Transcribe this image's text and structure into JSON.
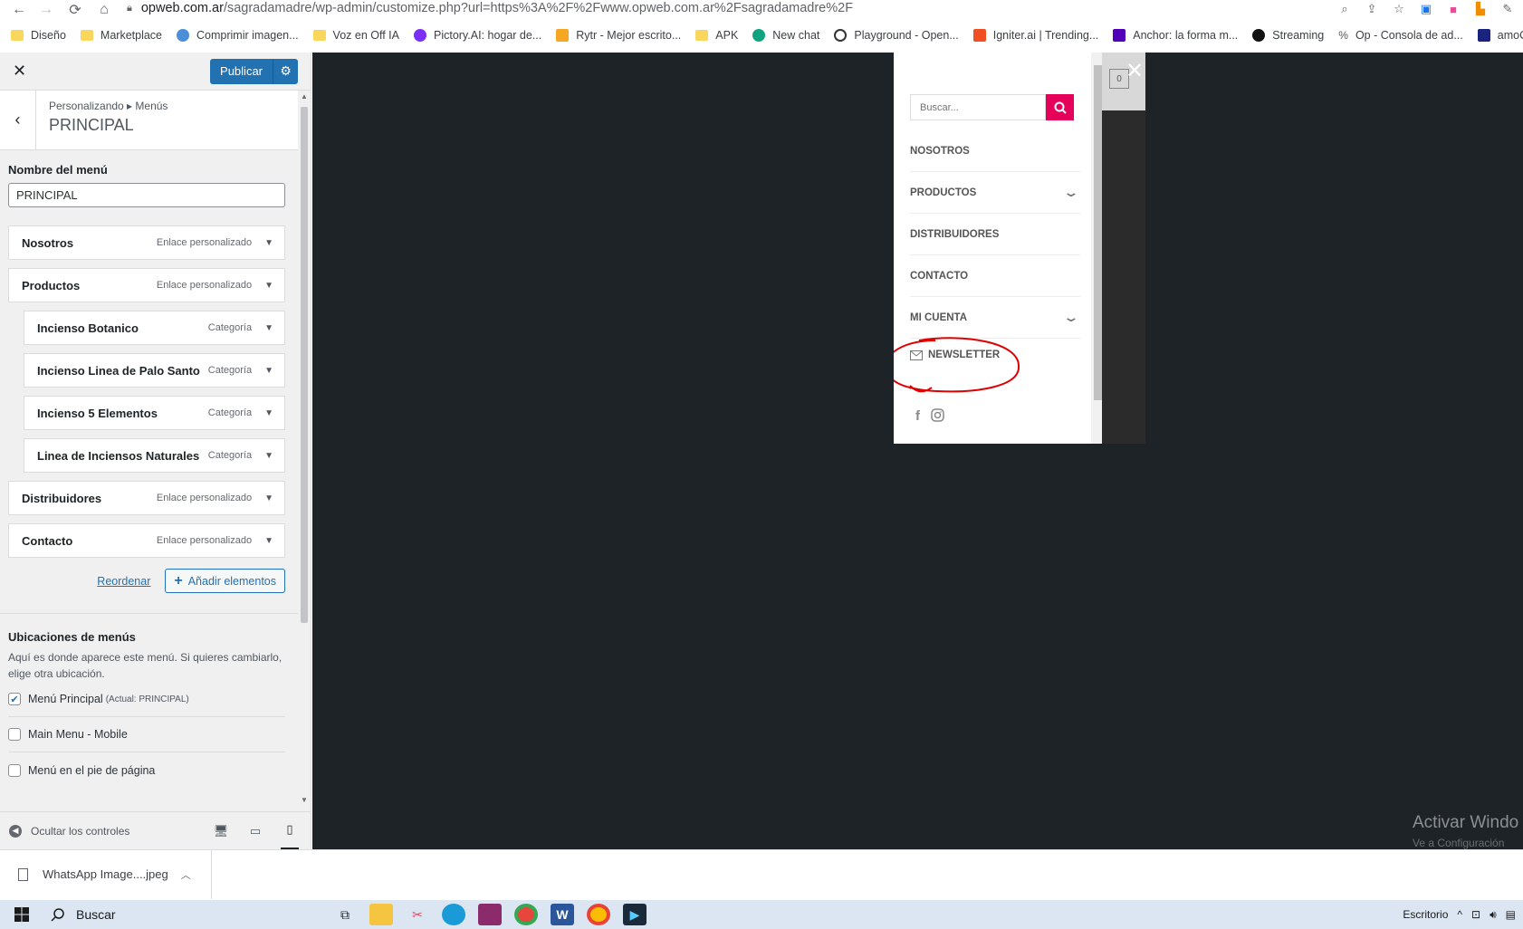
{
  "browser": {
    "url_domain": "opweb.com.ar",
    "url_path": "/sagradamadre/wp-admin/customize.php?url=https%3A%2F%2Fwww.opweb.com.ar%2Fsagradamadre%2F",
    "bookmarks": [
      {
        "label": "Diseño",
        "icon": "folder-icon"
      },
      {
        "label": "Marketplace",
        "icon": "folder-icon"
      },
      {
        "label": "Comprimir imagen...",
        "icon": "compress-icon"
      },
      {
        "label": "Voz en Off IA",
        "icon": "folder-icon"
      },
      {
        "label": "Pictory.AI: hogar de...",
        "icon": "pictory-icon"
      },
      {
        "label": "Rytr - Mejor escrito...",
        "icon": "rytr-icon"
      },
      {
        "label": "APK",
        "icon": "folder-icon"
      },
      {
        "label": "New chat",
        "icon": "chatgpt-icon"
      },
      {
        "label": "Playground - Open...",
        "icon": "openai-icon"
      },
      {
        "label": "Igniter.ai | Trending...",
        "icon": "igniter-icon"
      },
      {
        "label": "Anchor: la forma m...",
        "icon": "anchor-icon"
      },
      {
        "label": "Streaming",
        "icon": "streaming-icon"
      },
      {
        "label": "Op - Consola de ad...",
        "icon": "console-icon"
      },
      {
        "label": "amoCRM...",
        "icon": "amocrm-icon"
      }
    ]
  },
  "customizer": {
    "publish_label": "Publicar",
    "breadcrumb": "Personalizando ▸ Menús",
    "section_title": "PRINCIPAL",
    "menu_name_label": "Nombre del menú",
    "menu_name_value": "PRINCIPAL",
    "menu_items": [
      {
        "title": "Nosotros",
        "type": "Enlace personalizado",
        "sub": false
      },
      {
        "title": "Productos",
        "type": "Enlace personalizado",
        "sub": false
      },
      {
        "title": "Incienso Botanico",
        "type": "Categoría",
        "sub": true
      },
      {
        "title": "Incienso Linea de Palo Santo",
        "type": "Categoría",
        "sub": true
      },
      {
        "title": "Incienso 5 Elementos",
        "type": "Categoría",
        "sub": true
      },
      {
        "title": "Linea de Inciensos Naturales",
        "type": "Categoría",
        "sub": true
      },
      {
        "title": "Distribuidores",
        "type": "Enlace personalizado",
        "sub": false
      },
      {
        "title": "Contacto",
        "type": "Enlace personalizado",
        "sub": false
      }
    ],
    "reorder_label": "Reordenar",
    "add_items_label": "Añadir elementos",
    "locations_title": "Ubicaciones de menús",
    "locations_desc": "Aquí es donde aparece este menú. Si quieres cambiarlo, elige otra ubicación.",
    "locations": [
      {
        "label": "Menú Principal",
        "note": "(Actual: PRINCIPAL)",
        "checked": true
      },
      {
        "label": "Main Menu - Mobile",
        "note": "",
        "checked": false
      },
      {
        "label": "Menú en el pie de página",
        "note": "",
        "checked": false
      }
    ],
    "hide_controls_label": "Ocultar los controles"
  },
  "preview": {
    "search_placeholder": "Buscar...",
    "nav_items": [
      {
        "label": "NOSOTROS",
        "has_children": false
      },
      {
        "label": "PRODUCTOS",
        "has_children": true
      },
      {
        "label": "DISTRIBUIDORES",
        "has_children": false
      },
      {
        "label": "CONTACTO",
        "has_children": false
      },
      {
        "label": "MI CUENTA",
        "has_children": true
      }
    ],
    "newsletter_label": "NEWSLETTER",
    "cart_count": "0",
    "accent_color": "#e5005a",
    "highlight_color": "#e00000",
    "watermark_title": "Activar Windo",
    "watermark_sub": "Ve a Configuración"
  },
  "downloads": {
    "file_name": "WhatsApp Image....jpeg"
  },
  "taskbar": {
    "search_label": "Buscar",
    "desktop_label": "Escritorio"
  }
}
